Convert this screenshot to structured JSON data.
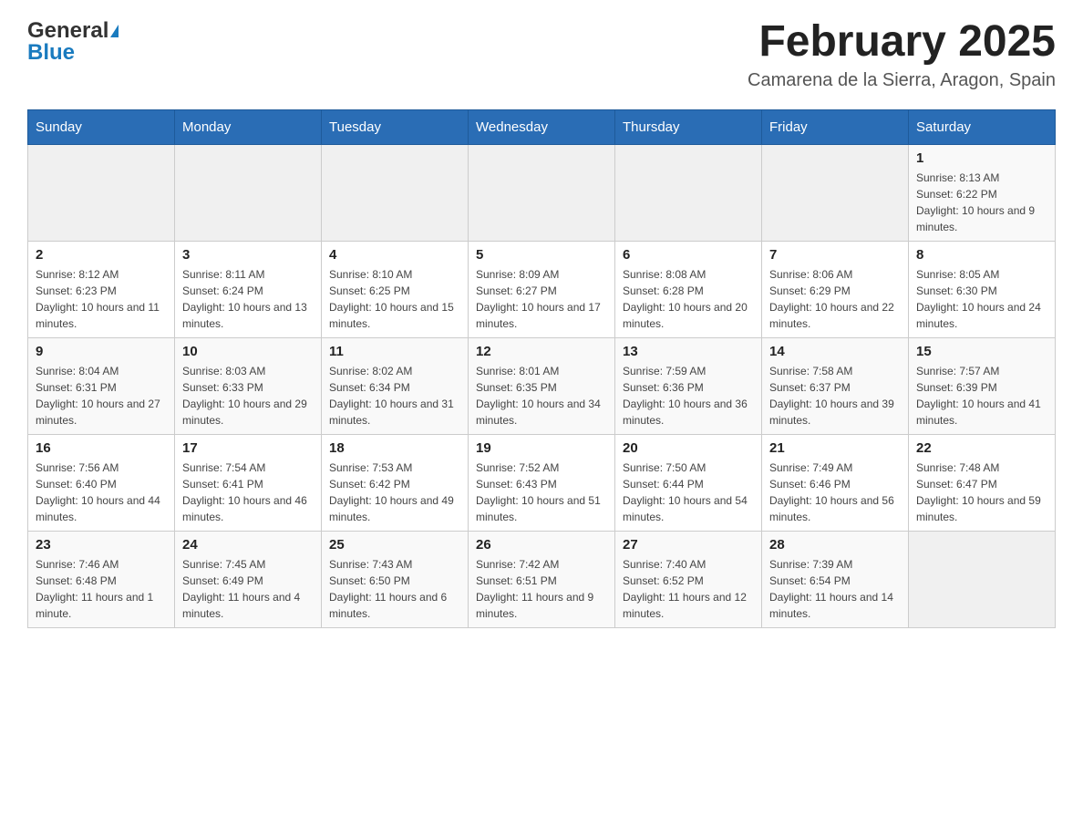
{
  "header": {
    "logo_text_general": "General",
    "logo_text_blue": "Blue",
    "month_title": "February 2025",
    "location": "Camarena de la Sierra, Aragon, Spain"
  },
  "calendar": {
    "days_of_week": [
      "Sunday",
      "Monday",
      "Tuesday",
      "Wednesday",
      "Thursday",
      "Friday",
      "Saturday"
    ],
    "weeks": [
      [
        {
          "day": "",
          "info": ""
        },
        {
          "day": "",
          "info": ""
        },
        {
          "day": "",
          "info": ""
        },
        {
          "day": "",
          "info": ""
        },
        {
          "day": "",
          "info": ""
        },
        {
          "day": "",
          "info": ""
        },
        {
          "day": "1",
          "info": "Sunrise: 8:13 AM\nSunset: 6:22 PM\nDaylight: 10 hours and 9 minutes."
        }
      ],
      [
        {
          "day": "2",
          "info": "Sunrise: 8:12 AM\nSunset: 6:23 PM\nDaylight: 10 hours and 11 minutes."
        },
        {
          "day": "3",
          "info": "Sunrise: 8:11 AM\nSunset: 6:24 PM\nDaylight: 10 hours and 13 minutes."
        },
        {
          "day": "4",
          "info": "Sunrise: 8:10 AM\nSunset: 6:25 PM\nDaylight: 10 hours and 15 minutes."
        },
        {
          "day": "5",
          "info": "Sunrise: 8:09 AM\nSunset: 6:27 PM\nDaylight: 10 hours and 17 minutes."
        },
        {
          "day": "6",
          "info": "Sunrise: 8:08 AM\nSunset: 6:28 PM\nDaylight: 10 hours and 20 minutes."
        },
        {
          "day": "7",
          "info": "Sunrise: 8:06 AM\nSunset: 6:29 PM\nDaylight: 10 hours and 22 minutes."
        },
        {
          "day": "8",
          "info": "Sunrise: 8:05 AM\nSunset: 6:30 PM\nDaylight: 10 hours and 24 minutes."
        }
      ],
      [
        {
          "day": "9",
          "info": "Sunrise: 8:04 AM\nSunset: 6:31 PM\nDaylight: 10 hours and 27 minutes."
        },
        {
          "day": "10",
          "info": "Sunrise: 8:03 AM\nSunset: 6:33 PM\nDaylight: 10 hours and 29 minutes."
        },
        {
          "day": "11",
          "info": "Sunrise: 8:02 AM\nSunset: 6:34 PM\nDaylight: 10 hours and 31 minutes."
        },
        {
          "day": "12",
          "info": "Sunrise: 8:01 AM\nSunset: 6:35 PM\nDaylight: 10 hours and 34 minutes."
        },
        {
          "day": "13",
          "info": "Sunrise: 7:59 AM\nSunset: 6:36 PM\nDaylight: 10 hours and 36 minutes."
        },
        {
          "day": "14",
          "info": "Sunrise: 7:58 AM\nSunset: 6:37 PM\nDaylight: 10 hours and 39 minutes."
        },
        {
          "day": "15",
          "info": "Sunrise: 7:57 AM\nSunset: 6:39 PM\nDaylight: 10 hours and 41 minutes."
        }
      ],
      [
        {
          "day": "16",
          "info": "Sunrise: 7:56 AM\nSunset: 6:40 PM\nDaylight: 10 hours and 44 minutes."
        },
        {
          "day": "17",
          "info": "Sunrise: 7:54 AM\nSunset: 6:41 PM\nDaylight: 10 hours and 46 minutes."
        },
        {
          "day": "18",
          "info": "Sunrise: 7:53 AM\nSunset: 6:42 PM\nDaylight: 10 hours and 49 minutes."
        },
        {
          "day": "19",
          "info": "Sunrise: 7:52 AM\nSunset: 6:43 PM\nDaylight: 10 hours and 51 minutes."
        },
        {
          "day": "20",
          "info": "Sunrise: 7:50 AM\nSunset: 6:44 PM\nDaylight: 10 hours and 54 minutes."
        },
        {
          "day": "21",
          "info": "Sunrise: 7:49 AM\nSunset: 6:46 PM\nDaylight: 10 hours and 56 minutes."
        },
        {
          "day": "22",
          "info": "Sunrise: 7:48 AM\nSunset: 6:47 PM\nDaylight: 10 hours and 59 minutes."
        }
      ],
      [
        {
          "day": "23",
          "info": "Sunrise: 7:46 AM\nSunset: 6:48 PM\nDaylight: 11 hours and 1 minute."
        },
        {
          "day": "24",
          "info": "Sunrise: 7:45 AM\nSunset: 6:49 PM\nDaylight: 11 hours and 4 minutes."
        },
        {
          "day": "25",
          "info": "Sunrise: 7:43 AM\nSunset: 6:50 PM\nDaylight: 11 hours and 6 minutes."
        },
        {
          "day": "26",
          "info": "Sunrise: 7:42 AM\nSunset: 6:51 PM\nDaylight: 11 hours and 9 minutes."
        },
        {
          "day": "27",
          "info": "Sunrise: 7:40 AM\nSunset: 6:52 PM\nDaylight: 11 hours and 12 minutes."
        },
        {
          "day": "28",
          "info": "Sunrise: 7:39 AM\nSunset: 6:54 PM\nDaylight: 11 hours and 14 minutes."
        },
        {
          "day": "",
          "info": ""
        }
      ]
    ]
  }
}
